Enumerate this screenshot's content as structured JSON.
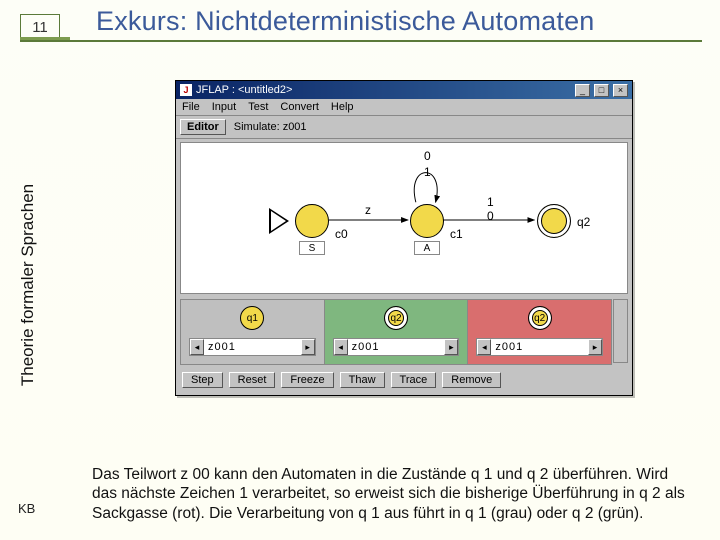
{
  "page": {
    "number": "11",
    "title": "Exkurs: Nichtdeterministische Automaten",
    "sidebar": "Theorie formaler Sprachen",
    "footer_tag": "KB",
    "body": "Das Teilwort z 00 kann den Automaten in die Zustände q 1 und q 2 überführen. Wird das nächste Zeichen 1 verarbeitet, so erweist sich die bisherige Überführung in q 2 als Sackgasse (rot). Die Verarbeitung von q 1 aus führt in q 1 (grau) oder q 2 (grün)."
  },
  "window": {
    "title": "JFLAP : <untitled2>",
    "menus": [
      "File",
      "Input",
      "Test",
      "Convert",
      "Help"
    ],
    "toolbar": {
      "editor_btn": "Editor",
      "mode_label": "Simulate: z001"
    },
    "winbuttons": {
      "min": "_",
      "max": "□",
      "close": "×"
    }
  },
  "automaton": {
    "states": [
      {
        "id": "c0",
        "below": "S"
      },
      {
        "id": "c1",
        "below": "A"
      },
      {
        "id": "q2",
        "below": ""
      }
    ],
    "self_loop_labels": [
      "0",
      "1"
    ],
    "edge_c0_c1": "z",
    "edge_c1_q2_labels": [
      "1",
      "0"
    ]
  },
  "sim": {
    "panels": [
      {
        "state": "q1",
        "tape": "z001",
        "color": "gray"
      },
      {
        "state": "q2",
        "tape": "z001",
        "color": "green"
      },
      {
        "state": "q2",
        "tape": "z001",
        "color": "red"
      }
    ],
    "buttons": [
      "Step",
      "Reset",
      "Freeze",
      "Thaw",
      "Trace",
      "Remove"
    ]
  }
}
